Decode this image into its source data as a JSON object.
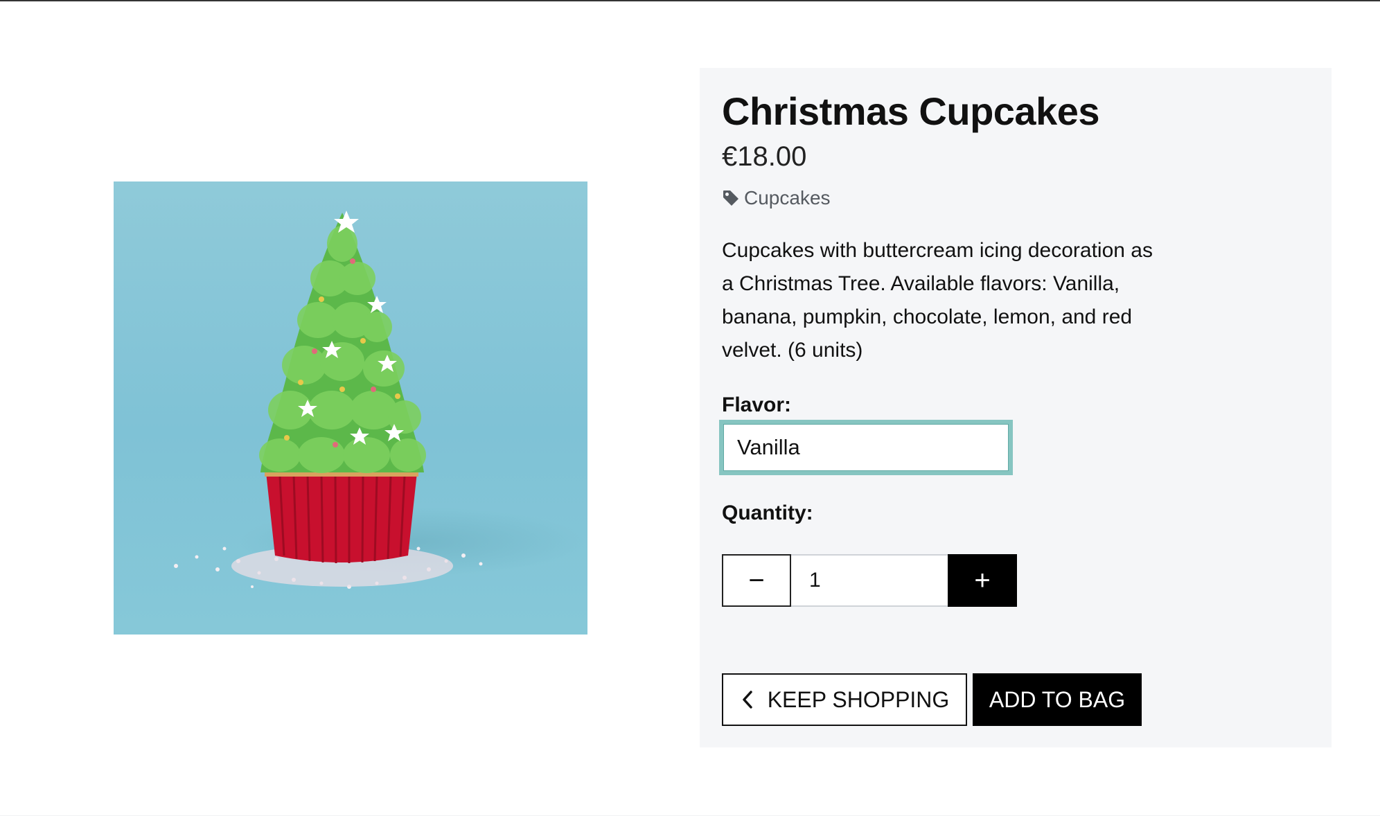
{
  "product": {
    "name": "Christmas Cupcakes",
    "price": "€18.00",
    "category": "Cupcakes",
    "description": "Cupcakes with buttercream icing decoration as a Christmas Tree. Available flavors: Vanilla, banana, pumpkin, chocolate, lemon, and red velvet. (6 units)",
    "image_alt": "Christmas tree cupcake"
  },
  "flavor": {
    "label": "Flavor:",
    "selected": "Vanilla"
  },
  "quantity": {
    "label": "Quantity:",
    "value": "1",
    "decrement_symbol": "−",
    "increment_symbol": "+"
  },
  "actions": {
    "keep_shopping_label": "KEEP SHOPPING",
    "add_to_bag_label": "ADD TO BAG"
  },
  "icons": {
    "category": "tag-icon",
    "back": "chevron-left-icon",
    "minus": "minus-icon",
    "plus": "plus-icon"
  },
  "colors": {
    "image_background": "#86c8d8",
    "panel_background": "#f5f6f8",
    "select_focus_border": "#86c5c1",
    "primary_button": "#000000"
  }
}
